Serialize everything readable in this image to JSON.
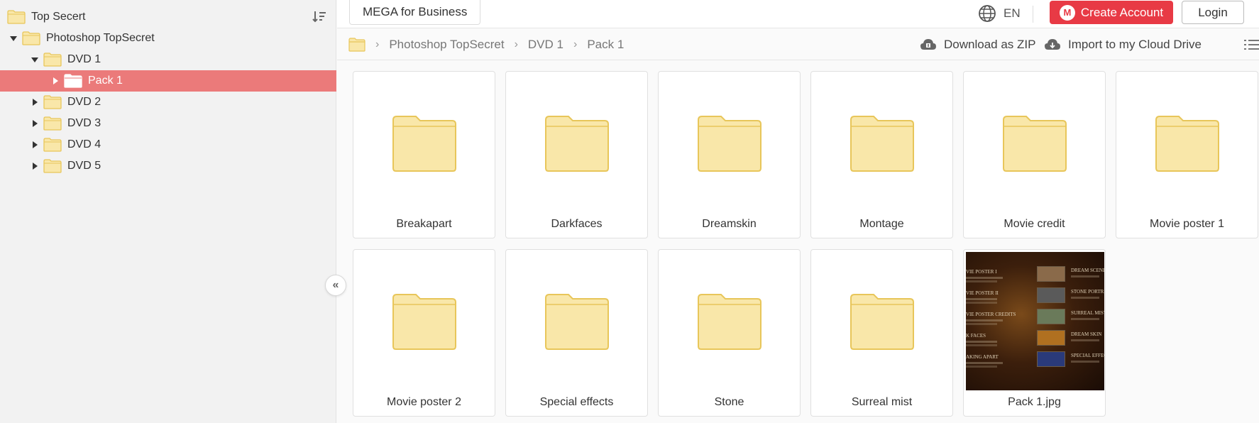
{
  "sidebar": {
    "tree": [
      {
        "label": "Top Secert",
        "level": 0,
        "caret": "none",
        "selected": false
      },
      {
        "label": "Photoshop TopSecret",
        "level": 1,
        "caret": "down",
        "selected": false
      },
      {
        "label": "DVD 1",
        "level": 2,
        "caret": "down",
        "selected": false
      },
      {
        "label": "Pack 1",
        "level": 3,
        "caret": "right",
        "selected": true
      },
      {
        "label": "DVD 2",
        "level": 2,
        "caret": "right",
        "selected": false
      },
      {
        "label": "DVD 3",
        "level": 2,
        "caret": "right",
        "selected": false
      },
      {
        "label": "DVD 4",
        "level": 2,
        "caret": "right",
        "selected": false
      },
      {
        "label": "DVD 5",
        "level": 2,
        "caret": "right",
        "selected": false
      }
    ],
    "sort_icon": "sort-icon",
    "collapse_glyph": "«"
  },
  "topbar": {
    "business_label": "MEGA for Business",
    "language": "EN",
    "create_account_label": "Create Account",
    "logo_letter": "M",
    "login_label": "Login"
  },
  "breadcrumb": {
    "items": [
      "Photoshop TopSecret",
      "DVD 1",
      "Pack 1"
    ],
    "separator": "›"
  },
  "actions": {
    "download_zip": "Download as ZIP",
    "import_cloud": "Import to my Cloud Drive"
  },
  "grid": {
    "items": [
      {
        "name": "Breakapart",
        "type": "folder"
      },
      {
        "name": "Darkfaces",
        "type": "folder"
      },
      {
        "name": "Dreamskin",
        "type": "folder"
      },
      {
        "name": "Montage",
        "type": "folder"
      },
      {
        "name": "Movie credit",
        "type": "folder"
      },
      {
        "name": "Movie poster 1",
        "type": "folder"
      },
      {
        "name": "Movie poster 2",
        "type": "folder"
      },
      {
        "name": "Special effects",
        "type": "folder"
      },
      {
        "name": "Stone",
        "type": "folder"
      },
      {
        "name": "Surreal mist",
        "type": "folder"
      },
      {
        "name": "Pack 1.jpg",
        "type": "image"
      }
    ]
  },
  "thumbnail_text": {
    "left": [
      "VIE POSTER I",
      "VIE POSTER II",
      "VIE POSTER CREDITS",
      "K FACES",
      "AKING APART"
    ],
    "right": [
      "DREAM SCENE",
      "STONE PORTRA",
      "SURREAL MIST",
      "DREAM SKIN",
      "SPECIAL EFFEC"
    ]
  },
  "colors": {
    "accent": "#e83a45",
    "selected_row": "#eb7a7a",
    "folder_fill": "#f9e7a9",
    "folder_stroke": "#e8c65a"
  }
}
